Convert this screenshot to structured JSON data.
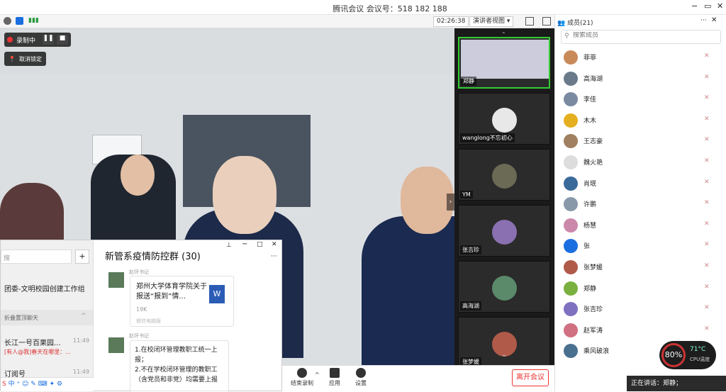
{
  "title": "腾讯会议 会议号：518 182 188",
  "toolbar": {
    "timer": "02:26:38",
    "view_mode": "演讲者视图"
  },
  "recording": {
    "label": "录制中",
    "unpin": "取消锁定"
  },
  "members": {
    "header": "成员(21)",
    "search_placeholder": "搜索成员",
    "list": [
      {
        "name": "菲菲",
        "color": "#c98a5a"
      },
      {
        "name": "高海湖",
        "color": "#6a7a8a"
      },
      {
        "name": "李佳",
        "color": "#7a8aa0"
      },
      {
        "name": "木木",
        "color": "#e5b020"
      },
      {
        "name": "王志豪",
        "color": "#a08060"
      },
      {
        "name": "魏火艳",
        "color": "#dddddd"
      },
      {
        "name": "肖珉",
        "color": "#3a6a9a"
      },
      {
        "name": "许鹏",
        "color": "#8899aa"
      },
      {
        "name": "杨慧",
        "color": "#cc88aa"
      },
      {
        "name": "张",
        "color": "#1a6ee0"
      },
      {
        "name": "张梦媛",
        "color": "#b05a4a"
      },
      {
        "name": "郑静",
        "color": "#7ab040"
      },
      {
        "name": "张吉珍",
        "color": "#8070c0"
      },
      {
        "name": "赵军涛",
        "color": "#d07080"
      },
      {
        "name": "乘风破浪",
        "color": "#4a7090"
      }
    ]
  },
  "strip": {
    "tiles": [
      {
        "name": "郑静",
        "color": "#ccd"
      },
      {
        "name": "wanglong不忘初心",
        "color": "#e8e8e8"
      },
      {
        "name": "YM",
        "color": "#6a6a55"
      },
      {
        "name": "张吉珍",
        "color": "#8a70b0"
      },
      {
        "name": "高海湖",
        "color": "#5a8a6a"
      },
      {
        "name": "张梦媛",
        "color": "#b05a4a"
      }
    ]
  },
  "bottom": {
    "stop_rec": "结束录制",
    "apps": "应用",
    "settings": "设置",
    "leave": "离开会议"
  },
  "speaking": "正在讲话：郑静；",
  "cpu": {
    "percent": "80%",
    "temp": "71°C",
    "label": "CPU温度"
  },
  "qq": {
    "group_title": "新管系疫情防控群 (30)",
    "search_placeholder": "搜",
    "left_items": [
      "团委-文明校园创建工作组",
      "折叠置顶聊天",
      "长江一号百果园...",
      "[有人@我]春天在哪里：...",
      "订阅号"
    ],
    "times": [
      "11:49",
      "11:49"
    ],
    "msg1_sender": "赵环书记",
    "file_name": "郑州大学体育学院关于报送“报到”情...",
    "file_size": "19K",
    "file_from": "微信电脑版",
    "msg2_sender": "赵环书记",
    "msg2_text": "1.在校闭环管理教职工统一上报；\n2.不在学校闭环管理的教职工（含党员和非党）均需要上报"
  }
}
